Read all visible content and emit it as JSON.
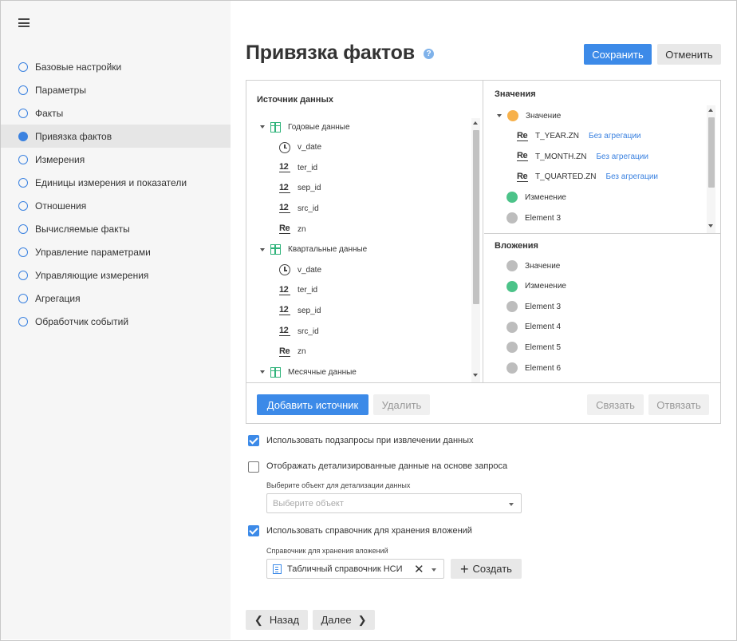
{
  "sidebar": {
    "items": [
      {
        "label": "Базовые настройки",
        "active": false
      },
      {
        "label": "Параметры",
        "active": false
      },
      {
        "label": "Факты",
        "active": false
      },
      {
        "label": "Привязка фактов",
        "active": true
      },
      {
        "label": "Измерения",
        "active": false
      },
      {
        "label": "Единицы измерения и показатели",
        "active": false
      },
      {
        "label": "Отношения",
        "active": false
      },
      {
        "label": "Вычисляемые факты",
        "active": false
      },
      {
        "label": "Управление параметрами",
        "active": false
      },
      {
        "label": "Управляющие измерения",
        "active": false
      },
      {
        "label": "Агрегация",
        "active": false
      },
      {
        "label": "Обработчик событий",
        "active": false
      }
    ]
  },
  "header": {
    "title": "Привязка фактов",
    "help": "?",
    "save_label": "Сохранить",
    "cancel_label": "Отменить"
  },
  "source": {
    "title": "Источник данных",
    "groups": [
      {
        "label": "Годовые данные",
        "fields": [
          {
            "icon": "clock",
            "label": "v_date"
          },
          {
            "icon": "12",
            "label": "ter_id"
          },
          {
            "icon": "12",
            "label": "sep_id"
          },
          {
            "icon": "12",
            "label": "src_id"
          },
          {
            "icon": "Re",
            "label": "zn"
          }
        ]
      },
      {
        "label": "Квартальные данные",
        "fields": [
          {
            "icon": "clock",
            "label": "v_date"
          },
          {
            "icon": "12",
            "label": "ter_id"
          },
          {
            "icon": "12",
            "label": "sep_id"
          },
          {
            "icon": "12",
            "label": "src_id"
          },
          {
            "icon": "Re",
            "label": "zn"
          }
        ]
      },
      {
        "label": "Месячные данные",
        "fields": []
      }
    ]
  },
  "values": {
    "title": "Значения",
    "root": {
      "label": "Значение",
      "color": "#f7b14b"
    },
    "children": [
      {
        "icon": "Re",
        "label": "T_YEAR.ZN",
        "link": "Без агрегации"
      },
      {
        "icon": "Re",
        "label": "T_MONTH.ZN",
        "link": "Без агрегации"
      },
      {
        "icon": "Re",
        "label": "T_QUARTED.ZN",
        "link": "Без агрегации"
      }
    ],
    "others": [
      {
        "label": "Изменение",
        "color": "#4cc389"
      },
      {
        "label": "Element 3",
        "color": "#bdbdbd"
      }
    ]
  },
  "attachments": {
    "title": "Вложения",
    "items": [
      {
        "label": "Значение",
        "color": "#bdbdbd"
      },
      {
        "label": "Изменение",
        "color": "#4cc389"
      },
      {
        "label": "Element 3",
        "color": "#bdbdbd"
      },
      {
        "label": "Element 4",
        "color": "#bdbdbd"
      },
      {
        "label": "Element 5",
        "color": "#bdbdbd"
      },
      {
        "label": "Element 6",
        "color": "#bdbdbd"
      }
    ]
  },
  "panel_actions": {
    "add_source": "Добавить источник",
    "delete": "Удалить",
    "link": "Связать",
    "unlink": "Отвязать"
  },
  "options": {
    "use_subqueries": {
      "label": "Использовать подзапросы при извлечении данных",
      "checked": true
    },
    "show_detail": {
      "label": "Отображать детализированные данные на основе запроса",
      "checked": false
    },
    "detail_object_label": "Выберите объект для детализации данных",
    "detail_object_placeholder": "Выберите объект",
    "use_dictionary": {
      "label": "Использовать справочник для хранения вложений",
      "checked": true
    },
    "dictionary_label": "Справочник для хранения вложений",
    "dictionary_value": "Табличный справочник НСИ",
    "create_label": "Создать"
  },
  "footer": {
    "back_label": "Назад",
    "next_label": "Далее"
  },
  "colors": {
    "accent": "#3c8ae8",
    "green": "#4cc389",
    "orange": "#f7b14b",
    "gray_dot": "#bdbdbd"
  }
}
